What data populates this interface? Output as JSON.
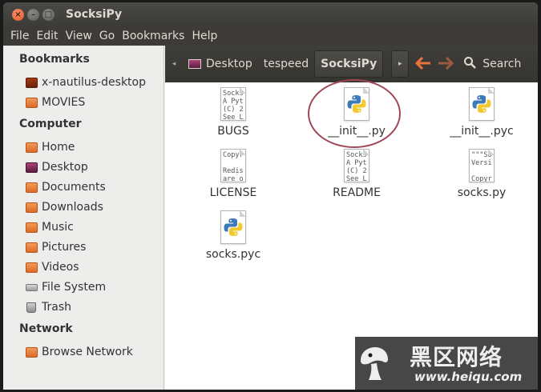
{
  "window": {
    "title": "SocksiPy",
    "buttons": {
      "close": "×",
      "minimize": "–",
      "maximize": "□"
    }
  },
  "menubar": {
    "items": [
      "File",
      "Edit",
      "View",
      "Go",
      "Bookmarks",
      "Help"
    ]
  },
  "sidebar": {
    "bookmarks": {
      "heading": "Bookmarks",
      "items": [
        {
          "label": "x-nautilus-desktop",
          "icon": "folder-dark-icon"
        },
        {
          "label": "MOVIES",
          "icon": "folder-icon"
        }
      ]
    },
    "computer": {
      "heading": "Computer",
      "items": [
        {
          "label": "Home",
          "icon": "home-folder-icon"
        },
        {
          "label": "Desktop",
          "icon": "desktop-icon"
        },
        {
          "label": "Documents",
          "icon": "documents-folder-icon"
        },
        {
          "label": "Downloads",
          "icon": "downloads-folder-icon"
        },
        {
          "label": "Music",
          "icon": "music-folder-icon"
        },
        {
          "label": "Pictures",
          "icon": "pictures-folder-icon"
        },
        {
          "label": "Videos",
          "icon": "videos-folder-icon"
        },
        {
          "label": "File System",
          "icon": "drive-icon"
        },
        {
          "label": "Trash",
          "icon": "trash-icon"
        }
      ]
    },
    "network": {
      "heading": "Network",
      "items": [
        {
          "label": "Browse Network",
          "icon": "network-folder-icon"
        }
      ]
    }
  },
  "toolbar": {
    "left_arrow": "◂",
    "breadcrumbs": [
      "Desktop",
      "tespeed",
      "SocksiPy"
    ],
    "right_arrow": "▸",
    "back": "🡐",
    "forward": "🡒",
    "search_icon": "⚲",
    "search_label": "Search"
  },
  "files": [
    {
      "name": "BUGS",
      "kind": "text",
      "preview": "Socks\nA Pyt\n(C) 2\nSee L"
    },
    {
      "name": "__init__.py",
      "kind": "python"
    },
    {
      "name": "__init__.pyc",
      "kind": "python"
    },
    {
      "name": "LICENSE",
      "kind": "text",
      "preview": "Copyr\n\nRedis\nare o"
    },
    {
      "name": "README",
      "kind": "text",
      "preview": "Socks\nA Pyt\n(C) 2\nSee L"
    },
    {
      "name": "socks.py",
      "kind": "text",
      "preview": "\"\"\"So\nVersi\n\nCopyr"
    },
    {
      "name": "socks.pyc",
      "kind": "python"
    }
  ],
  "watermark": {
    "chinese": "黑区网络",
    "url": "www.heiqu.com"
  },
  "colors": {
    "accent_orange": "#e8743a",
    "title_bar": "#3c3b37",
    "highlight_circle": "#a04757"
  }
}
